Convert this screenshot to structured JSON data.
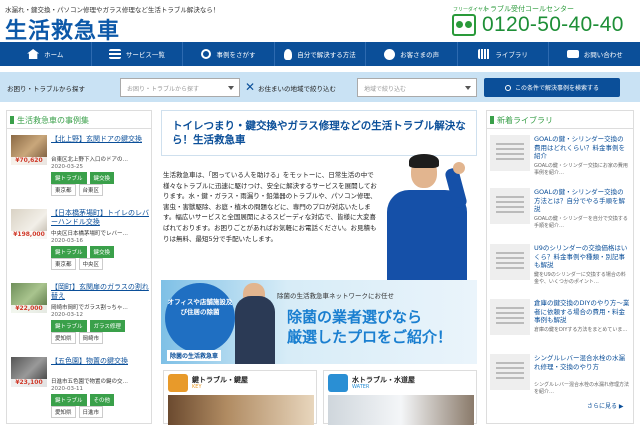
{
  "header": {
    "tagline": "水漏れ・鍵交換・パソコン修理やガラス修理など生活トラブル解決なら！",
    "logo": "生活救急車",
    "freedial_label": "フリーダイヤル",
    "call_center_label": "トラブル受付コールセンター",
    "phone": "0120-50-40-40"
  },
  "nav": {
    "items": [
      {
        "label": "ホーム",
        "icon": "home-icon"
      },
      {
        "label": "サービス一覧",
        "icon": "list-icon"
      },
      {
        "label": "事例をさがす",
        "icon": "search-icon"
      },
      {
        "label": "自分で解決する方法",
        "icon": "bulb-icon"
      },
      {
        "label": "お客さまの声",
        "icon": "user-icon"
      },
      {
        "label": "ライブラリ",
        "icon": "library-icon"
      },
      {
        "label": "お問い合わせ",
        "icon": "mail-icon"
      }
    ]
  },
  "search": {
    "trouble_label": "お困り・トラブルから探す",
    "trouble_placeholder": "お困り・トラブルから探す",
    "area_label": "お住まいの地域で絞り込む",
    "area_placeholder": "地域で絞り込む",
    "button": "この条件で解決事例を検索する"
  },
  "cases": {
    "heading": "生活救急車の事例集",
    "items": [
      {
        "price": "¥70,620",
        "title": "【北上野】玄関ドアの鍵交換",
        "desc": "台東区北上野下入口のドアの…",
        "date": "2020-03-25",
        "tags": [
          "鍵トラブル",
          "鍵交換"
        ],
        "areas": [
          "東京都",
          "台東区"
        ]
      },
      {
        "price": "¥198,000",
        "title": "【日本橋茅場町】トイレのレバーハンドル交換",
        "desc": "中央区日本橋茅場町でレバー…",
        "date": "2020-03-16",
        "tags": [
          "鍵トラブル",
          "鍵交換"
        ],
        "areas": [
          "東京都",
          "中央区"
        ]
      },
      {
        "price": "¥22,000",
        "title": "【岡町】玄関扉のガラスの割れ替え",
        "desc": "岡崎市岡町でガラス割っちゃ…",
        "date": "2020-03-12",
        "tags": [
          "鍵トラブル",
          "ガラス修理"
        ],
        "areas": [
          "愛知県",
          "岡崎市"
        ]
      },
      {
        "price": "¥23,100",
        "title": "【五色園】物置の鍵交換",
        "desc": "日進市五色園で物置の鍵の交…",
        "date": "2020-03-11",
        "tags": [
          "鍵トラブル",
          "その他"
        ],
        "areas": [
          "愛知県",
          "日進市"
        ]
      }
    ]
  },
  "main": {
    "hero_title": "トイレつまり・鍵交換やガラス修理などの生活トラブル解決なら！生活救急車",
    "intro": "生活救急車は、「困っている人を助ける」をモットーに、日常生活の中で様々なトラブルに迅速に駆けつけ、安全に解決するサービスを展開しております。水・鍵・ガラス・雨漏り・鉛蕩器のトラブルや、パソコン修理、害虫・害獣駆除、お庭・植木の問題などに、専門のプロが対応いたします。幅広いサービスと全国展開によるスピーディな対応で、皆様に大変喜ばれております。お困りごとがあればお気軽にお電話ください。お見積もりは無料、最短5分で手配いたします。",
    "banner": {
      "circle_text": "オフィスや店舗施設及び住居の除菌",
      "brand": "除菌の生活救急車",
      "subtitle": "除菌の生活救急車ネットワークにお任せ",
      "line1": "除菌の業者選びなら",
      "line2": "厳選したプロをご紹介！"
    },
    "categories": [
      {
        "title": "鍵トラブル・鍵屋",
        "sub": "KEY",
        "color": "#e89a2a"
      },
      {
        "title": "水トラブル・水道屋",
        "sub": "WATER",
        "color": "#2a8fd4"
      }
    ]
  },
  "library": {
    "heading": "新着ライブラリ",
    "items": [
      {
        "title": "GOALの鍵・シリンダー交換の費用はどれくらい？料金事例を紹介",
        "desc": "GOALの鍵・シリンダー交換にお家の費用事例を紹介…"
      },
      {
        "title": "GOALの鍵・シリンダー交換の方法とは？自分でやる手順を解説",
        "desc": "GOALの鍵・シリンダーを自分で交換する手順を紹介…"
      },
      {
        "title": "U9のシリンダーの交換価格はいくら？料金事例や種類・別記事も解説",
        "desc": "鍵をU9のシリンダーに交換する場合の料金や、いくつかのポイント…"
      },
      {
        "title": "倉庫の鍵交換のDIYのやり方～業者に依頼する場合の費用・料金事例も解説",
        "desc": "倉庫の鍵をDIYする方法をまとめていま…"
      },
      {
        "title": "シングルレバー混合水栓の水漏れ修理・交換のやり方",
        "desc": "シングルレバー混合水栓の水漏れ修理方法を紹介…"
      }
    ],
    "more": "さらに見る ▶"
  },
  "colors": {
    "brand": "#0b4f99",
    "green": "#3aa04a",
    "phone": "#1e8f37",
    "price": "#d03a2a"
  }
}
